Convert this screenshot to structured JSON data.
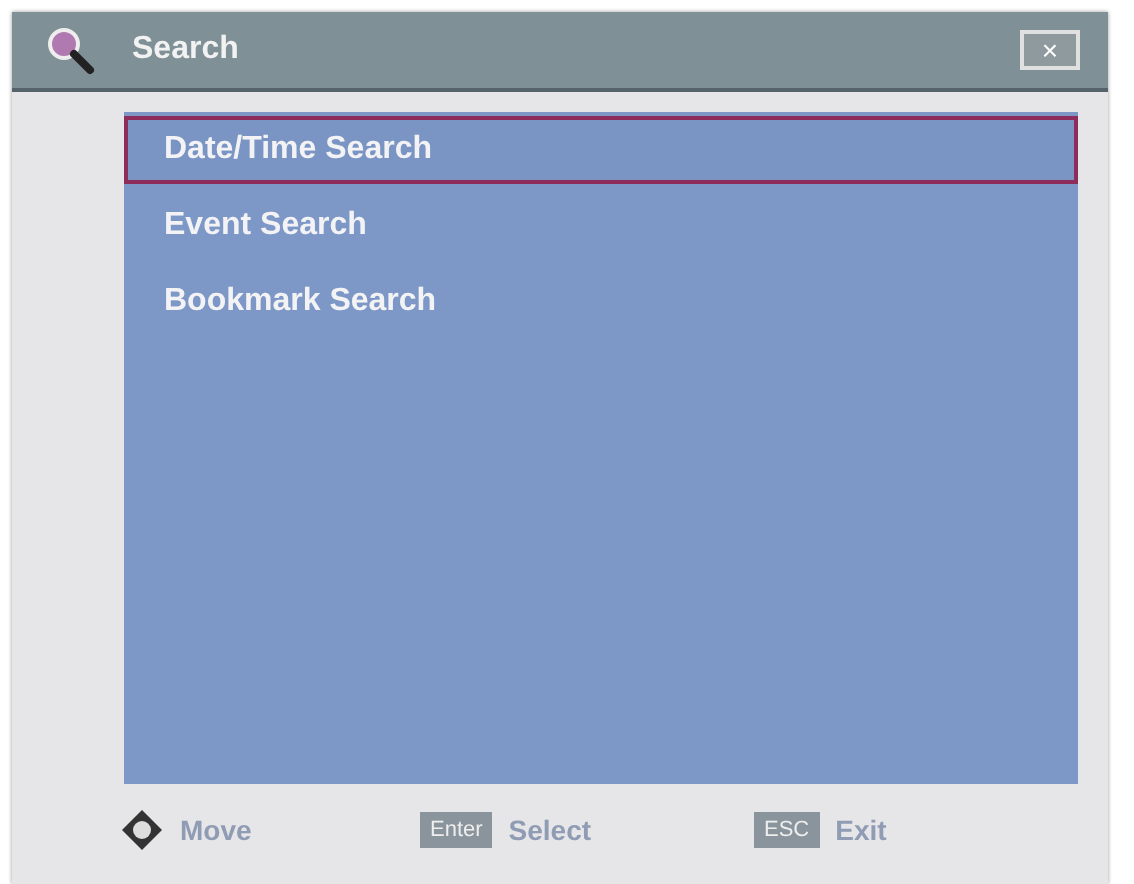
{
  "window": {
    "title": "Search",
    "close": "×"
  },
  "menu": [
    {
      "label": "Date/Time Search",
      "selected": true
    },
    {
      "label": "Event Search",
      "selected": false
    },
    {
      "label": "Bookmark Search",
      "selected": false
    }
  ],
  "hints": [
    {
      "kind": "dpad",
      "label": "Move"
    },
    {
      "kind": "key",
      "key": "Enter",
      "label": "Select"
    },
    {
      "kind": "key",
      "key": "ESC",
      "label": "Exit"
    }
  ]
}
